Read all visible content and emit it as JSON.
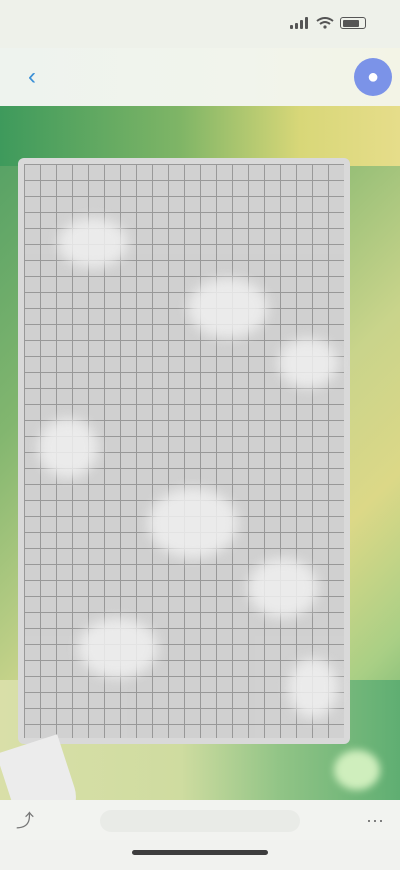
{
  "status_bar": {
    "time": "",
    "icons": [
      "signal-icon",
      "wifi-icon",
      "battery-icon"
    ]
  },
  "nav": {
    "back_icon": "chevron-left-icon",
    "back_glyph": "‹",
    "title": "",
    "action_icon": "profile-icon",
    "action_glyph": "●"
  },
  "image": {
    "description_colors": {
      "background_green": "#4f9e63",
      "background_yellow": "#dcd887",
      "sheet_gray": "#d9d9d9"
    }
  },
  "toolbar": {
    "left_icon": "share-icon",
    "left_glyph": "⤴",
    "right_icon": "more-icon",
    "right_glyph": "⋯"
  }
}
